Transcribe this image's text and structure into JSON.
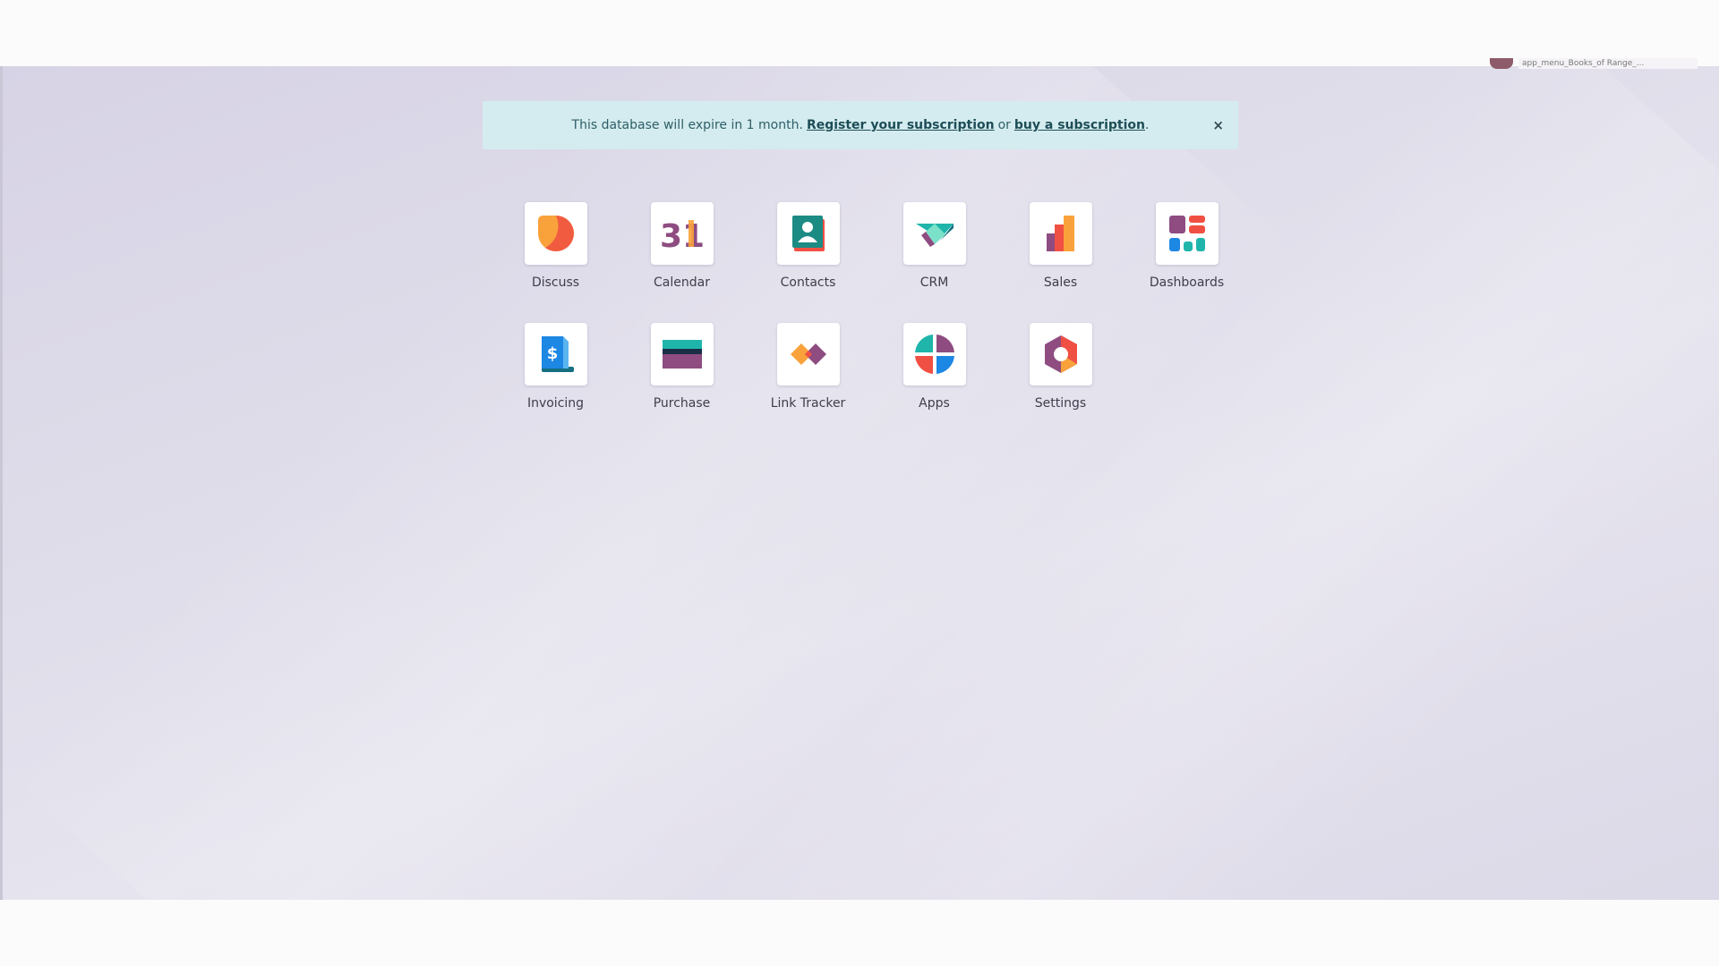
{
  "user": {
    "name": "app_menu_Books_of Range_..."
  },
  "banner": {
    "text_before": "This database will expire in 1 month.",
    "register_link": "Register your subscription",
    "or": "or",
    "buy_link": "buy a subscription",
    "period": ".",
    "close": "×"
  },
  "apps": [
    {
      "label": "Discuss",
      "icon": "discuss-icon"
    },
    {
      "label": "Calendar",
      "icon": "calendar-icon",
      "icon_text": "31"
    },
    {
      "label": "Contacts",
      "icon": "contacts-icon"
    },
    {
      "label": "CRM",
      "icon": "crm-icon"
    },
    {
      "label": "Sales",
      "icon": "sales-icon"
    },
    {
      "label": "Dashboards",
      "icon": "dashboards-icon"
    },
    {
      "label": "Invoicing",
      "icon": "invoicing-icon",
      "icon_text": "$"
    },
    {
      "label": "Purchase",
      "icon": "purchase-icon"
    },
    {
      "label": "Link Tracker",
      "icon": "link-tracker-icon"
    },
    {
      "label": "Apps",
      "icon": "apps-icon"
    },
    {
      "label": "Settings",
      "icon": "settings-icon"
    }
  ],
  "colors": {
    "banner_bg": "#d4ecef",
    "banner_text": "#2f5e67",
    "orange": "#f9a23b",
    "purple": "#8e4c81",
    "teal": "#1fb5ab",
    "red": "#f05043",
    "blue": "#1d87e4"
  }
}
